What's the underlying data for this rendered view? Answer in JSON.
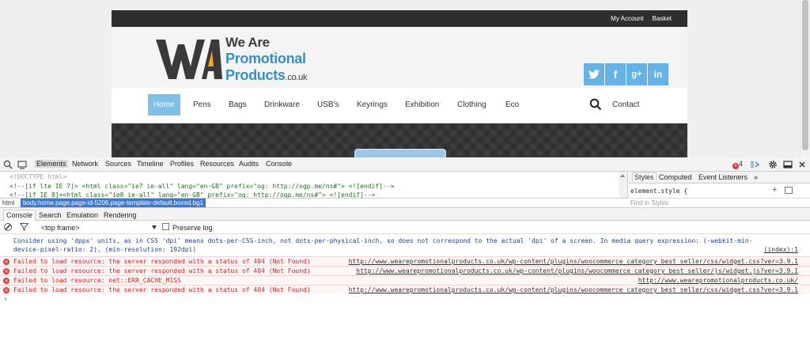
{
  "site": {
    "top_links": [
      "My Account",
      "Basket"
    ],
    "logo": {
      "line1": "We Are",
      "line2": "Promotional",
      "line3": "Products",
      "line3_suffix": ".co.uk",
      "accent_color": "#f5a623",
      "blue": "#3590c9"
    },
    "social": [
      {
        "icon": "twitter-icon",
        "glyph": "t"
      },
      {
        "icon": "facebook-icon",
        "glyph": "f"
      },
      {
        "icon": "google-plus-icon",
        "glyph": "g+"
      },
      {
        "icon": "linkedin-icon",
        "glyph": "in"
      }
    ],
    "nav": [
      "Home",
      "Pens",
      "Bags",
      "Drinkware",
      "USB's",
      "Keyrings",
      "Exhibition",
      "Clothing",
      "Eco"
    ],
    "nav_contact": "Contact",
    "nav_active_color": "#7ec0e7"
  },
  "devtools": {
    "panel_tabs": [
      "Elements",
      "Network",
      "Sources",
      "Timeline",
      "Profiles",
      "Resources",
      "Audits",
      "Console"
    ],
    "active_panel": "Elements",
    "error_count": "4",
    "elements_code": [
      "<!DOCTYPE html>",
      "<!--[if lte IE 7]> <html class=\"ie7 ie-all\" lang=\"en-GB\" prefix=\"og: http://ogp.me/ns#\"> <![endif]-->",
      "<!--[if IE 8]><html class=\"ie8 ie-all\" lang=\"en-GB\" prefix=\"og: http://ogp.me/ns#\"> <![endif]-->"
    ],
    "breadcrumb_html": "html",
    "breadcrumb_body": "body.home.page.page-id-5206.page-template-default.boxed.bg1",
    "styles_tabs": [
      "Styles",
      "Computed",
      "Event Listeners",
      "»"
    ],
    "element_style": "element.style {",
    "find_placeholder": "Find in Styles",
    "drawer_tabs": [
      "Console",
      "Search",
      "Emulation",
      "Rendering"
    ],
    "frame_select": "<top frame>",
    "preserve_log": "Preserve log",
    "console": {
      "info_line1": "Consider using 'dppx' units, as in CSS 'dpi' means dots-per-CSS-inch, not dots-per-physical-inch, so does not correspond to the actual 'dpi' of a screen. In media query expression: (-webkit-min-",
      "info_line2": "device-pixel-ratio: 2), (min-resolution: 192dpi)",
      "info_source": "(index):1",
      "errors": [
        {
          "text": "Failed to load resource: the server responded with a status of 404 (Not Found)",
          "source": "http://www.wearepromotionalproducts.co.uk/wp-content/plugins/woocommerce_category_best_seller/css/widget.css?ver=3.9.1"
        },
        {
          "text": "Failed to load resource: the server responded with a status of 404 (Not Found)",
          "source": "http://www.wearepromotionalproducts.co.uk/wp-content/plugins/woocommerce_category_best_seller/js/widget.js?ver=3.9.1"
        },
        {
          "text": "Failed to load resource: net::ERR_CACHE_MISS",
          "source": "http://www.wearepromotionalproducts.co.uk/"
        },
        {
          "text": "Failed to load resource: the server responded with a status of 404 (Not Found)",
          "source": "http://www.wearepromotionalproducts.co.uk/wp-content/plugins/woocommerce_category_best_seller/css/widget.css?ver=3.9.1"
        }
      ],
      "prompt": "›"
    }
  }
}
